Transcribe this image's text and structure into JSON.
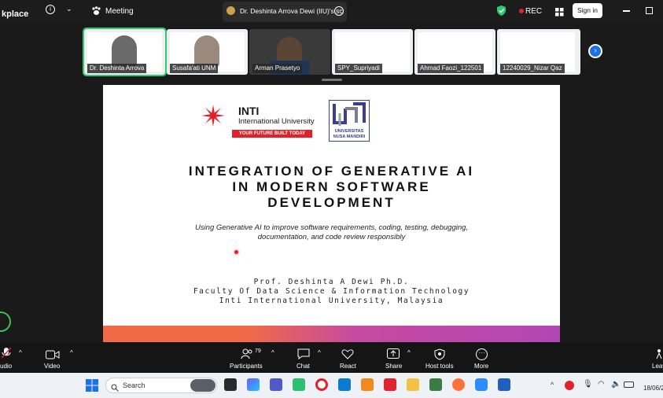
{
  "top": {
    "app_name_partial": "kplace",
    "meeting_label": "Meeting",
    "tab_title": "Dr. Deshinta Arrova Dewi (IIU)'s sc",
    "rec_label": "REC",
    "signin_label": "Sign in"
  },
  "participants_strip": [
    {
      "name": "Dr. Deshinta Arrova",
      "active": true
    },
    {
      "name": "Susafa'ati UNM"
    },
    {
      "name": "Arman Prasetyo"
    },
    {
      "name": "SPY_Supriyadi"
    },
    {
      "name": "Ahmad Faozi_122501"
    },
    {
      "name": "12240029_Nizar Qaz"
    }
  ],
  "slide": {
    "logo_inti_title": "INTI",
    "logo_inti_sub": "International University",
    "logo_inti_tag": "YOUR FUTURE BUILT TODAY",
    "logo_unm_text1": "UNIVERSITAS",
    "logo_unm_text2": "NUSA MANDIRI",
    "title_line1": "INTEGRATION OF GENERATIVE AI",
    "title_line2": "IN MODERN SOFTWARE",
    "title_line3": "DEVELOPMENT",
    "subtitle_line1": "Using Generative AI to improve software requirements, coding, testing, debugging,",
    "subtitle_line2": "documentation, and code review responsibly",
    "author_line1": "Prof. Deshinta A Dewi Ph.D.",
    "author_line2": "Faculty Of Data Science & Information Technology",
    "author_line3": "Inti International University, Malaysia"
  },
  "zoombar": {
    "audio": "udio",
    "video": "Video",
    "participants": "Participants",
    "participants_count": "79",
    "chat": "Chat",
    "react": "React",
    "share": "Share",
    "host_tools": "Host tools",
    "more": "More",
    "leave": "Leav"
  },
  "taskbar": {
    "search_placeholder": "Search",
    "date_partial": "18/06/2"
  },
  "colors": {
    "active_green": "#2ecc71",
    "rec_red": "#e0242f",
    "inti_red": "#e3202a",
    "unm_blue": "#3a3f8f"
  }
}
